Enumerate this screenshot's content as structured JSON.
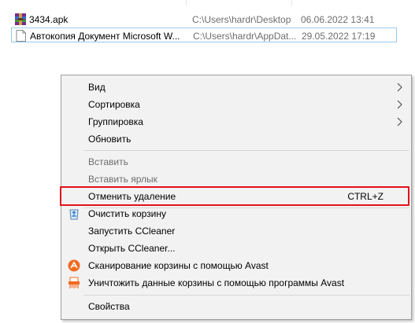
{
  "files": [
    {
      "name": "3434.apk",
      "path": "C:\\Users\\hardr\\Desktop",
      "date": "06.06.2022 13:41",
      "icon": "winrar-archive-icon"
    },
    {
      "name": "Автокопия Документ Microsoft W...",
      "path": "C:\\Users\\hardr\\AppDat...",
      "date": "29.05.2022 17:19",
      "icon": "document-icon"
    }
  ],
  "menu": {
    "view": "Вид",
    "sort": "Сортировка",
    "group": "Группировка",
    "refresh": "Обновить",
    "paste": "Вставить",
    "paste_shortcut": "Вставить ярлык",
    "undo_delete": "Отменить удаление",
    "undo_delete_shortcut": "CTRL+Z",
    "empty_bin": "Очистить корзину",
    "run_ccleaner": "Запустить CCleaner",
    "open_ccleaner": "Открыть CCleaner...",
    "avast_scan": "Сканирование корзины с помощью Avast",
    "avast_shred": "Уничтожить данные корзины с помощью программы Avast",
    "properties": "Свойства"
  },
  "colors": {
    "highlight": "#e3101b",
    "avast_orange": "#f26a21",
    "menu_bg": "#f2f2f2"
  }
}
